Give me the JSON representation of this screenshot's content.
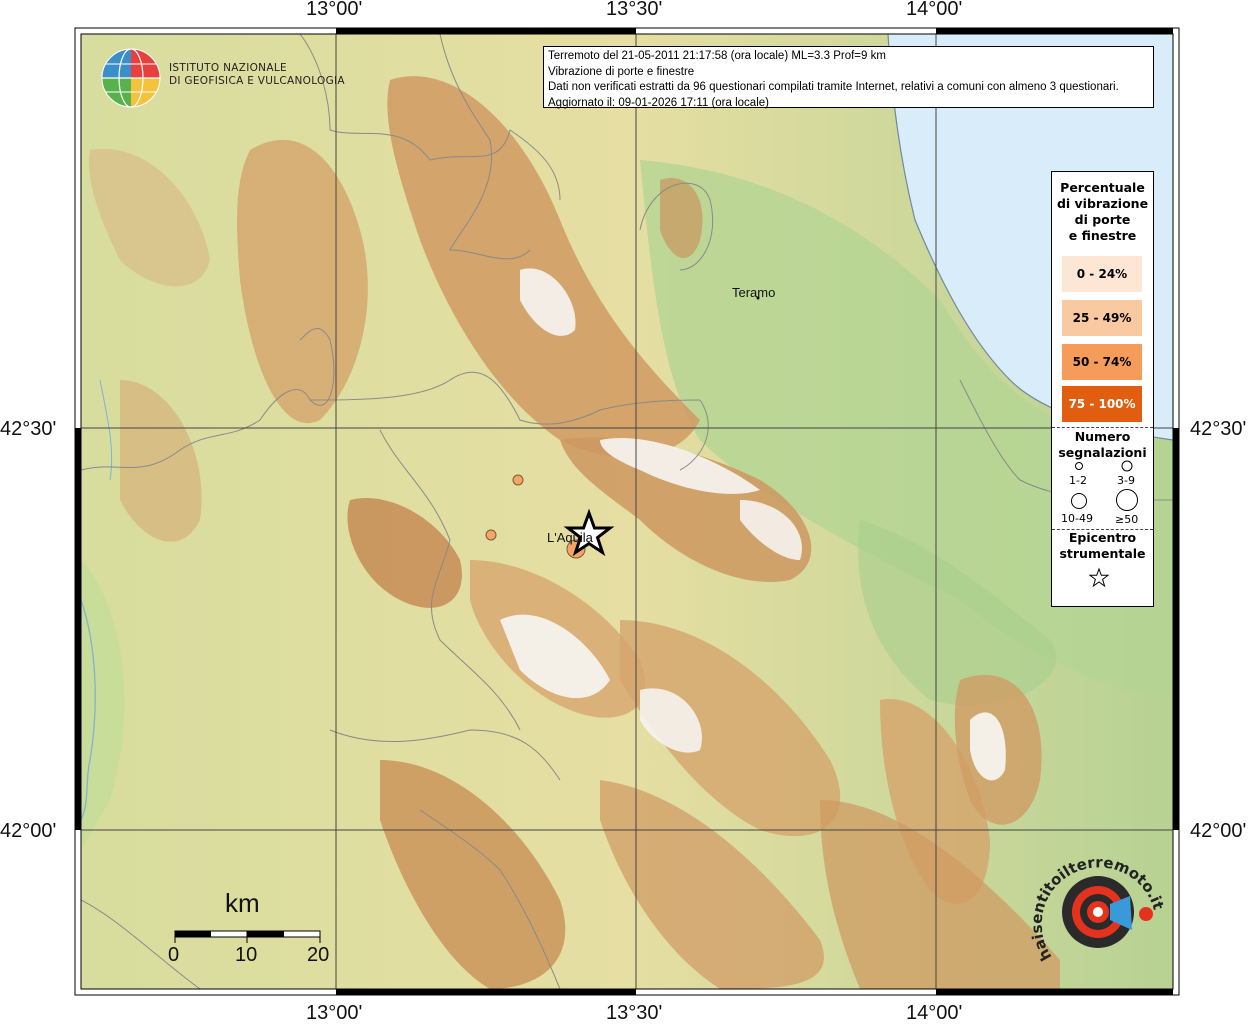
{
  "coords": {
    "top": [
      "13°00'",
      "13°30'",
      "14°00'"
    ],
    "bottom": [
      "13°00'",
      "13°30'",
      "14°00'"
    ],
    "left": [
      "42°30'",
      "42°00'"
    ],
    "right": [
      "42°30'",
      "42°00'"
    ]
  },
  "info": {
    "line1": "Terremoto del 21-05-2011 21:17:58 (ora locale) ML=3.3 Prof=9 km",
    "line2": "Vibrazione di porte e finestre",
    "line3": "Dati non verificati estratti da 96 questionari compilati tramite Internet, relativi a comuni con almeno 3 questionari.",
    "line4": "Aggiornato il: 09-01-2026 17:11 (ora locale)"
  },
  "logo": {
    "line1": "ISTITUTO NAZIONALE",
    "line2": "DI GEOFISICA E VULCANOLOGIA"
  },
  "legend": {
    "title": [
      "Percentuale",
      "di vibrazione",
      "di porte",
      "e finestre"
    ],
    "classes": [
      {
        "label": "0 - 24%",
        "color": "#fde7d4"
      },
      {
        "label": "25 - 49%",
        "color": "#f9c9a2"
      },
      {
        "label": "50 - 74%",
        "color": "#f59c5a"
      },
      {
        "label": "75 - 100%",
        "color": "#e15e10"
      }
    ],
    "count_title": [
      "Numero",
      "segnalazioni"
    ],
    "count_classes": [
      "1-2",
      "3-9",
      "10-49",
      "≥50"
    ],
    "epicenter_title": [
      "Epicentro",
      "strumentale"
    ]
  },
  "cities": {
    "teramo": "Teramo",
    "laquila": "L'Aquila"
  },
  "scale": {
    "unit": "km",
    "ticks": [
      "0",
      "10",
      "20"
    ]
  },
  "badge_text": "haisentitoilterremoto.it",
  "colors": {
    "sea": "#d8edf9",
    "lowland": "#a8c98a",
    "hill": "#e6dfa0",
    "mountain": "#d2a26a",
    "peak": "#f4f1ec",
    "report_fill": "#f4a463"
  }
}
